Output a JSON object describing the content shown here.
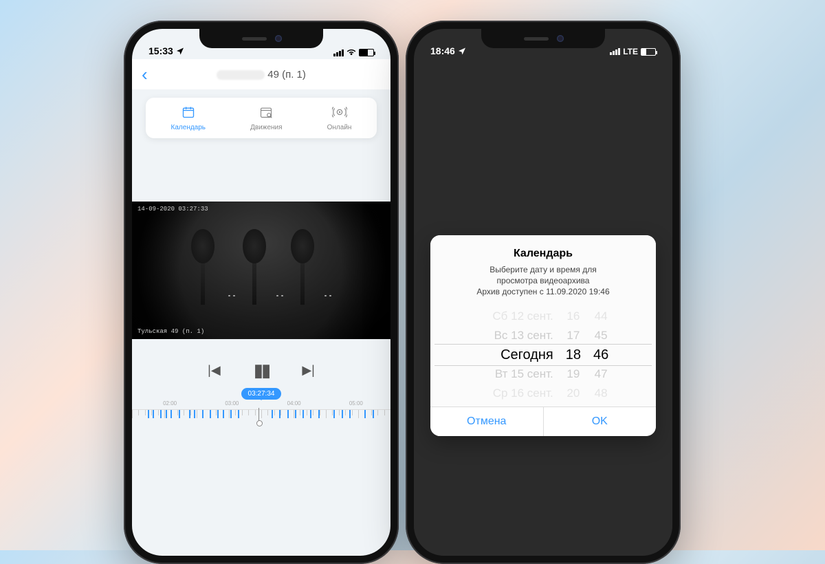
{
  "left": {
    "status_time": "15:33",
    "nav_title_suffix": "49  (п. 1)",
    "tabs": {
      "calendar": "Календарь",
      "motion": "Движения",
      "online": "Онлайн"
    },
    "video_overlay_top": "14-09-2020  03:27:33",
    "video_overlay_bottom": "Тульская 49  (п. 1)",
    "scrub_time": "03:27:34",
    "ruler_labels": {
      "l1": "02:00",
      "l2": "03:00",
      "l3": "04:00",
      "l4": "05:00"
    }
  },
  "right": {
    "status_time": "18:46",
    "status_net": "LTE",
    "sheet": {
      "title": "Календарь",
      "msg_line1": "Выберите дату и время для",
      "msg_line2": "просмотра видеоархива",
      "msg_line3": "Архив доступен с 11.09.2020 19:46",
      "picker": {
        "dates": [
          "Сб 12 сент.",
          "Вс 13 сент.",
          "Сегодня",
          "Вт 15 сент.",
          "Ср 16 сент."
        ],
        "hours": [
          "16",
          "17",
          "18",
          "19",
          "20"
        ],
        "mins": [
          "44",
          "45",
          "46",
          "47",
          "48"
        ]
      },
      "cancel": "Отмена",
      "ok": "OK"
    }
  }
}
